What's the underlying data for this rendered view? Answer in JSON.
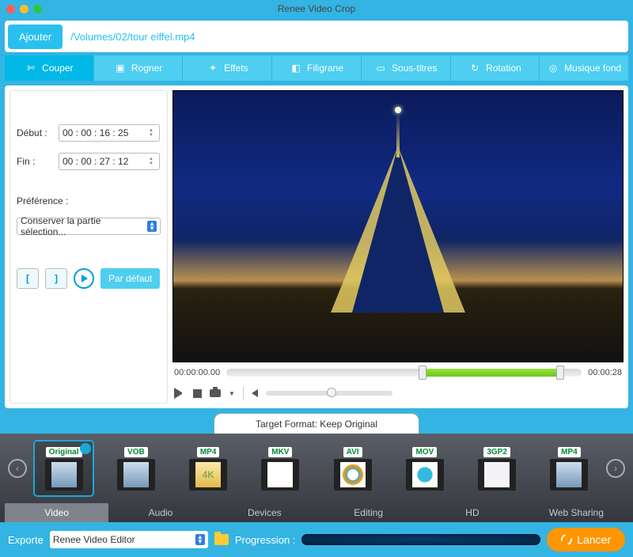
{
  "window": {
    "title": "Renee Video Crop"
  },
  "topbar": {
    "add_label": "Ajouter",
    "filepath": "/Volumes/02/tour eiffel.mp4"
  },
  "tabs": [
    {
      "label": "Couper"
    },
    {
      "label": "Rogner"
    },
    {
      "label": "Effets"
    },
    {
      "label": "Filigrane"
    },
    {
      "label": "Sous-titres"
    },
    {
      "label": "Rotation"
    },
    {
      "label": "Musique fond"
    }
  ],
  "cut": {
    "start_label": "Début :",
    "end_label": "Fin :",
    "start_value": "00 : 00  :  16  :  25",
    "end_value": "00 : 00  :  27  :  12",
    "pref_label": "Préférence :",
    "pref_value": "Conserver la partie sélection...",
    "default_label": "Par défaut"
  },
  "player": {
    "pos": "00:00:00.00",
    "dur": "00:00:28"
  },
  "target": {
    "label": "Target Format: Keep Original"
  },
  "formats": [
    {
      "label": "Original"
    },
    {
      "label": "VOB"
    },
    {
      "label": "MP4",
      "sub": "4K"
    },
    {
      "label": "MKV"
    },
    {
      "label": "AVI"
    },
    {
      "label": "MOV"
    },
    {
      "label": "3GP2"
    },
    {
      "label": "MP4"
    }
  ],
  "catTabs": [
    "Video",
    "Audio",
    "Devices",
    "Editing",
    "HD",
    "Web Sharing"
  ],
  "footer": {
    "export_label": "Exporte",
    "export_value": "Renee Video Editor",
    "prog_label": "Progression :",
    "launch_label": "Lancer"
  }
}
